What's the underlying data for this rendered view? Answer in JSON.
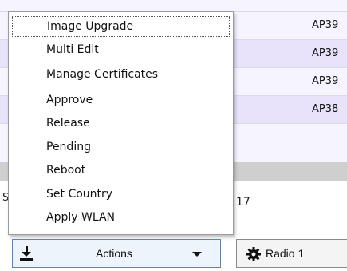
{
  "table": {
    "rows": [
      {
        "col2": "AP39"
      },
      {
        "col2": "AP39"
      },
      {
        "col2": "AP39"
      },
      {
        "col2": "AP38"
      }
    ]
  },
  "status": {
    "left_fragment": "S",
    "right_fragment": "17"
  },
  "menu": {
    "items": [
      {
        "label": "Image Upgrade"
      },
      {
        "label": "Multi Edit"
      },
      {
        "label": "Manage Certificates"
      },
      {
        "label": "Approve"
      },
      {
        "label": "Release"
      },
      {
        "label": "Pending"
      },
      {
        "label": "Reboot"
      },
      {
        "label": "Set Country"
      },
      {
        "label": "Apply WLAN"
      }
    ]
  },
  "toolbar": {
    "actions_label": "Actions",
    "radio_label": "Radio 1"
  },
  "colors": {
    "actions_border": "#4b88c7",
    "row_lavender": "#e8e2fb"
  }
}
